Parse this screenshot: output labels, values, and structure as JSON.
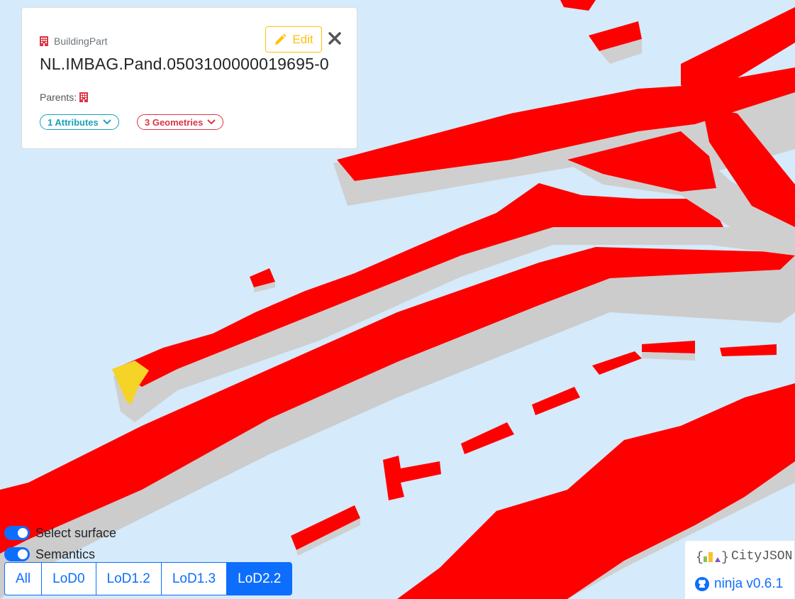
{
  "colors": {
    "sky": "#d5eafa",
    "roof": "#ff0000",
    "wall": "#cfcfcf",
    "selected": "#f5d327",
    "primary": "#0d6efd"
  },
  "info_card": {
    "type_label": "BuildingPart",
    "type_icon": "building-icon",
    "object_id": "NL.IMBAG.Pand.0503100000019695-0",
    "parents_label": "Parents:",
    "parent_icon": "building-icon",
    "attributes_label": "1 Attributes",
    "geometries_label": "3 Geometries",
    "edit_label": "Edit",
    "edit_icon": "pencil-icon",
    "close_icon": "close-icon"
  },
  "toggles": [
    {
      "label": "Select surface",
      "on": true
    },
    {
      "label": "Semantics",
      "on": true
    }
  ],
  "lod_buttons": [
    {
      "label": "All",
      "active": false
    },
    {
      "label": "LoD0",
      "active": false
    },
    {
      "label": "LoD1.2",
      "active": false
    },
    {
      "label": "LoD1.3",
      "active": false
    },
    {
      "label": "LoD2.2",
      "active": true
    }
  ],
  "branding": {
    "logo_text": "CityJSON",
    "version_text": "ninja v0.6.1",
    "github_icon": "github-icon"
  }
}
